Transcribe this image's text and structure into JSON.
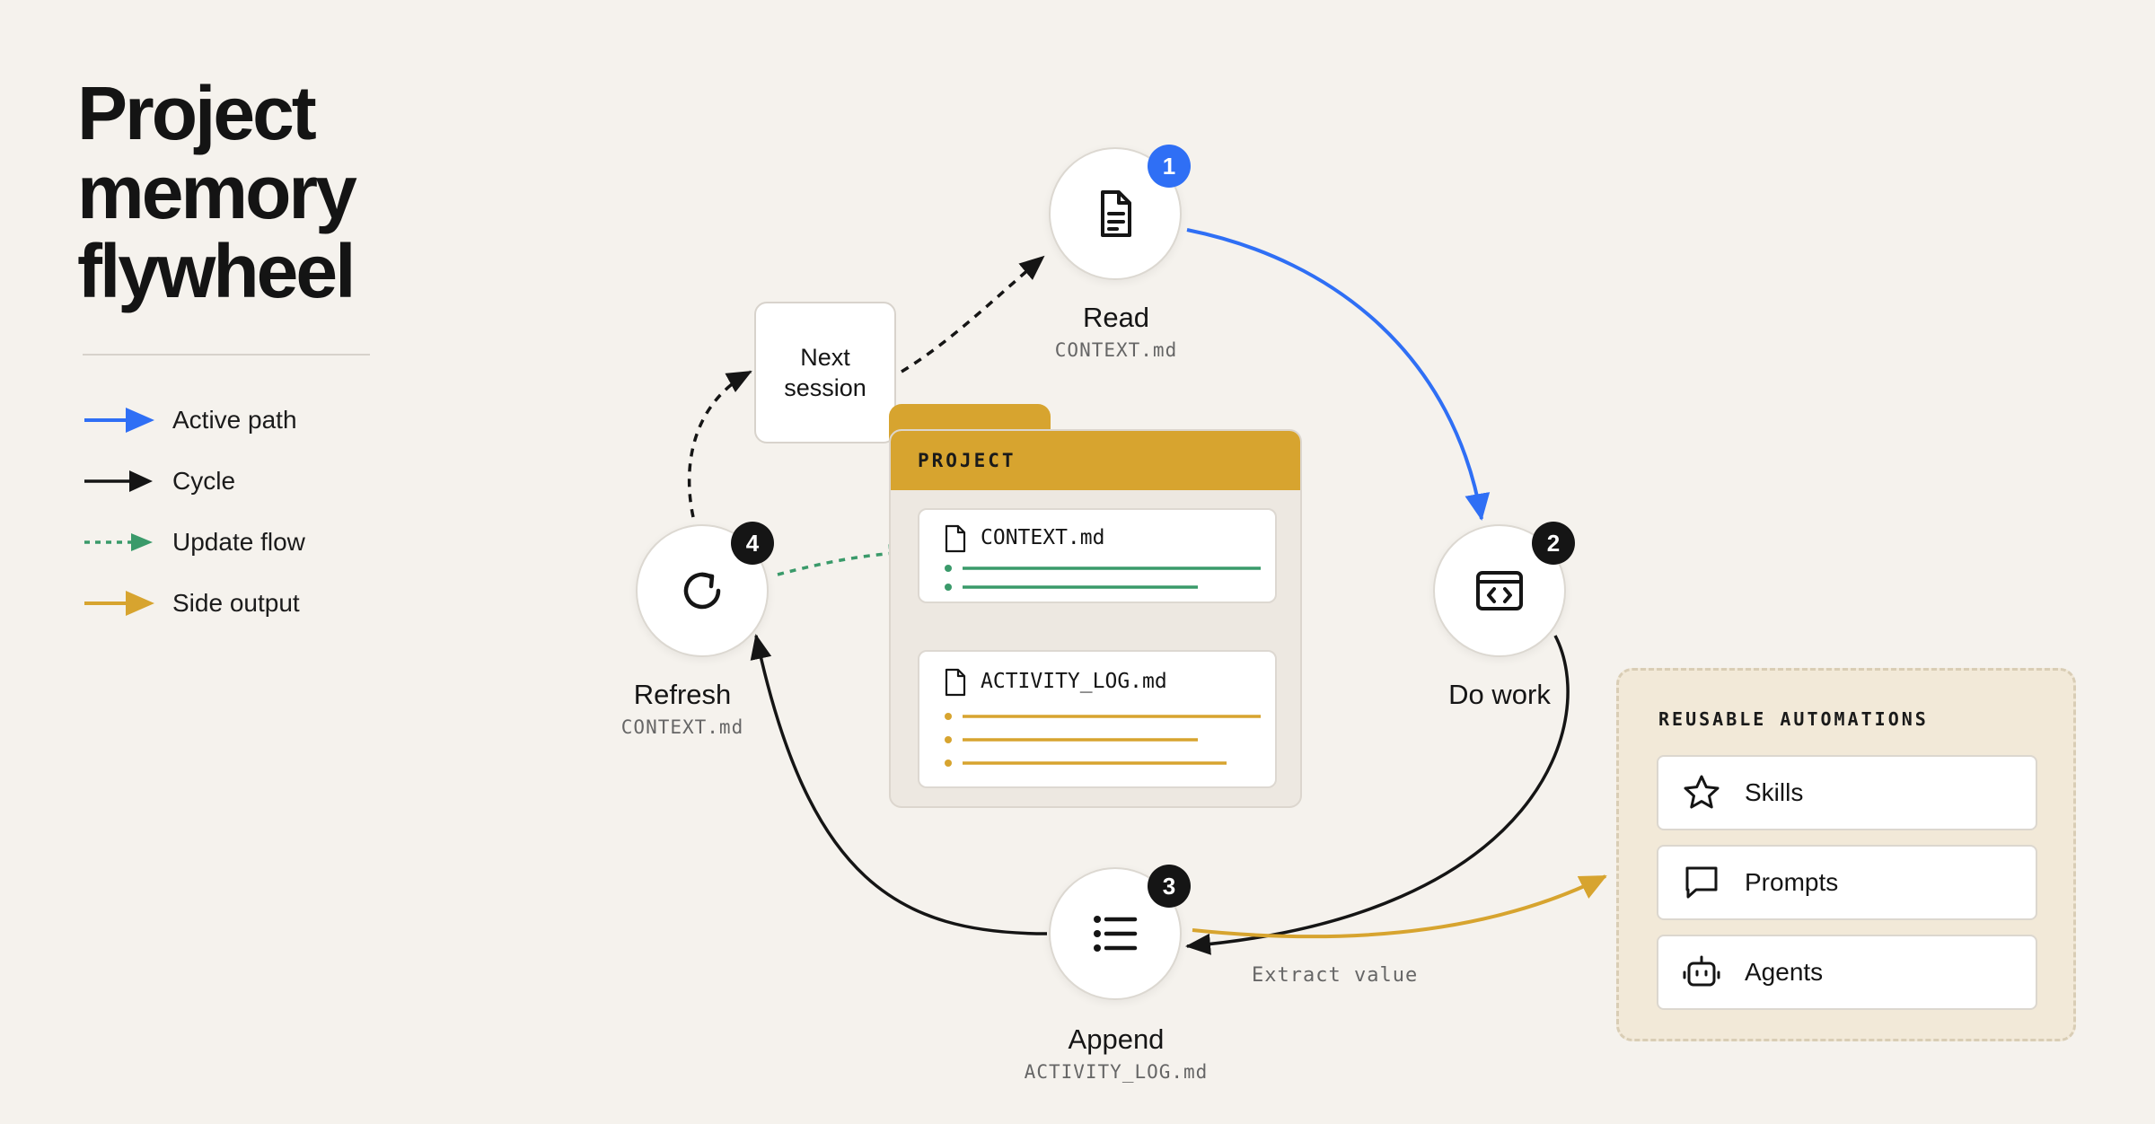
{
  "title": [
    "Project",
    "memory",
    "flywheel"
  ],
  "legend": [
    {
      "label": "Active path",
      "color": "#2f6ff5",
      "style": "solid"
    },
    {
      "label": "Cycle",
      "color": "#151515",
      "style": "solid"
    },
    {
      "label": "Update flow",
      "color": "#3a9a6a",
      "style": "dashed"
    },
    {
      "label": "Side output",
      "color": "#d7a42f",
      "style": "solid"
    }
  ],
  "steps": {
    "read": {
      "badge": "1",
      "label": "Read",
      "file": "CONTEXT.md",
      "icon": "document-icon"
    },
    "do_work": {
      "badge": "2",
      "label": "Do work",
      "icon": "code-window-icon"
    },
    "append": {
      "badge": "3",
      "label": "Append",
      "file": "ACTIVITY_LOG.md",
      "icon": "list-icon"
    },
    "refresh": {
      "badge": "4",
      "label": "Refresh",
      "file": "CONTEXT.md",
      "icon": "refresh-icon"
    }
  },
  "next_session": {
    "line1": "Next",
    "line2": "session"
  },
  "project": {
    "label": "PROJECT",
    "files": [
      {
        "name": "CONTEXT.md",
        "color": "#3a9a6a"
      },
      {
        "name": "ACTIVITY_LOG.md",
        "color": "#d7a42f"
      }
    ]
  },
  "extract_label": "Extract value",
  "automations": {
    "heading": "REUSABLE AUTOMATIONS",
    "items": [
      {
        "label": "Skills",
        "icon": "star-icon"
      },
      {
        "label": "Prompts",
        "icon": "speech-bubble-icon"
      },
      {
        "label": "Agents",
        "icon": "robot-icon"
      }
    ]
  }
}
